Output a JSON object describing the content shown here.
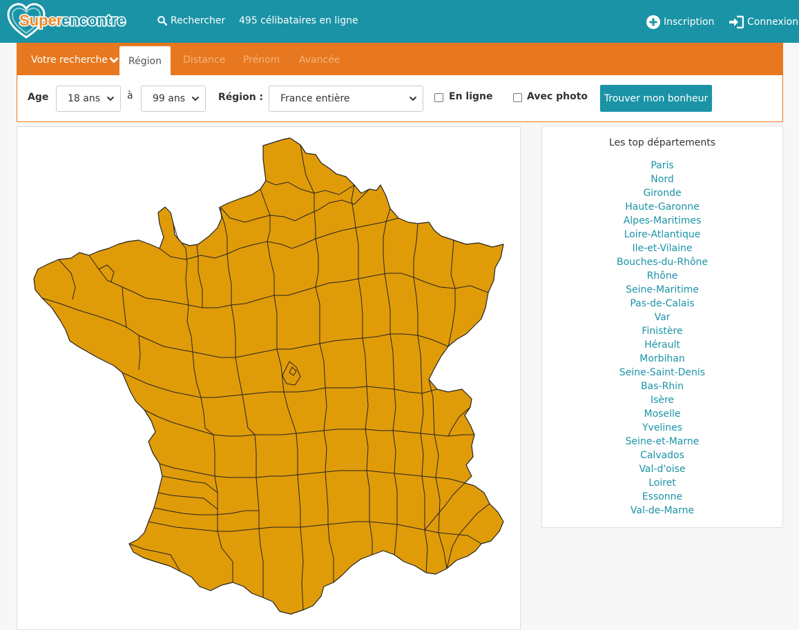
{
  "header": {
    "logo_text": "Superencontre",
    "search_label": "Rechercher",
    "online_count": "495 célibataires en ligne",
    "signup_label": "Inscription",
    "login_label": "Connexion",
    "colors": {
      "bar": "#1a93a6",
      "logo_orange": "#f08a24"
    }
  },
  "search": {
    "tabs": {
      "votre_recherche": "Votre recherche",
      "region": "Région",
      "distance": "Distance",
      "prenom": "Prénom",
      "avancee": "Avancée"
    },
    "age_label": "Age",
    "age_min": "18 ans",
    "to_label": "à",
    "age_max": "99 ans",
    "region_label": "Région :",
    "region_value": "France entière",
    "online_label": "En ligne",
    "online_checked": false,
    "photo_label": "Avec photo",
    "photo_checked": false,
    "submit_label": "Trouver mon bonheur",
    "colors": {
      "accent": "#e7781f"
    }
  },
  "map": {
    "fill": "#e09b09",
    "stroke": "#222222"
  },
  "top_departements": {
    "title": "Les top départements",
    "items": [
      "Paris",
      "Nord",
      "Gironde",
      "Haute-Garonne",
      "Alpes-Maritimes",
      "Loire-Atlantique",
      "Ile-et-Vilaine",
      "Bouches-du-Rhône",
      "Rhône",
      "Seine-Maritime",
      "Pas-de-Calais",
      "Var",
      "Finistère",
      "Hérault",
      "Morbihan",
      "Seine-Saint-Denis",
      "Bas-Rhin",
      "Isère",
      "Moselle",
      "Yvelines",
      "Seine-et-Marne",
      "Calvados",
      "Val-d'oise",
      "Loiret",
      "Essonne",
      "Val-de-Marne"
    ],
    "link_color": "#1a93a6"
  }
}
